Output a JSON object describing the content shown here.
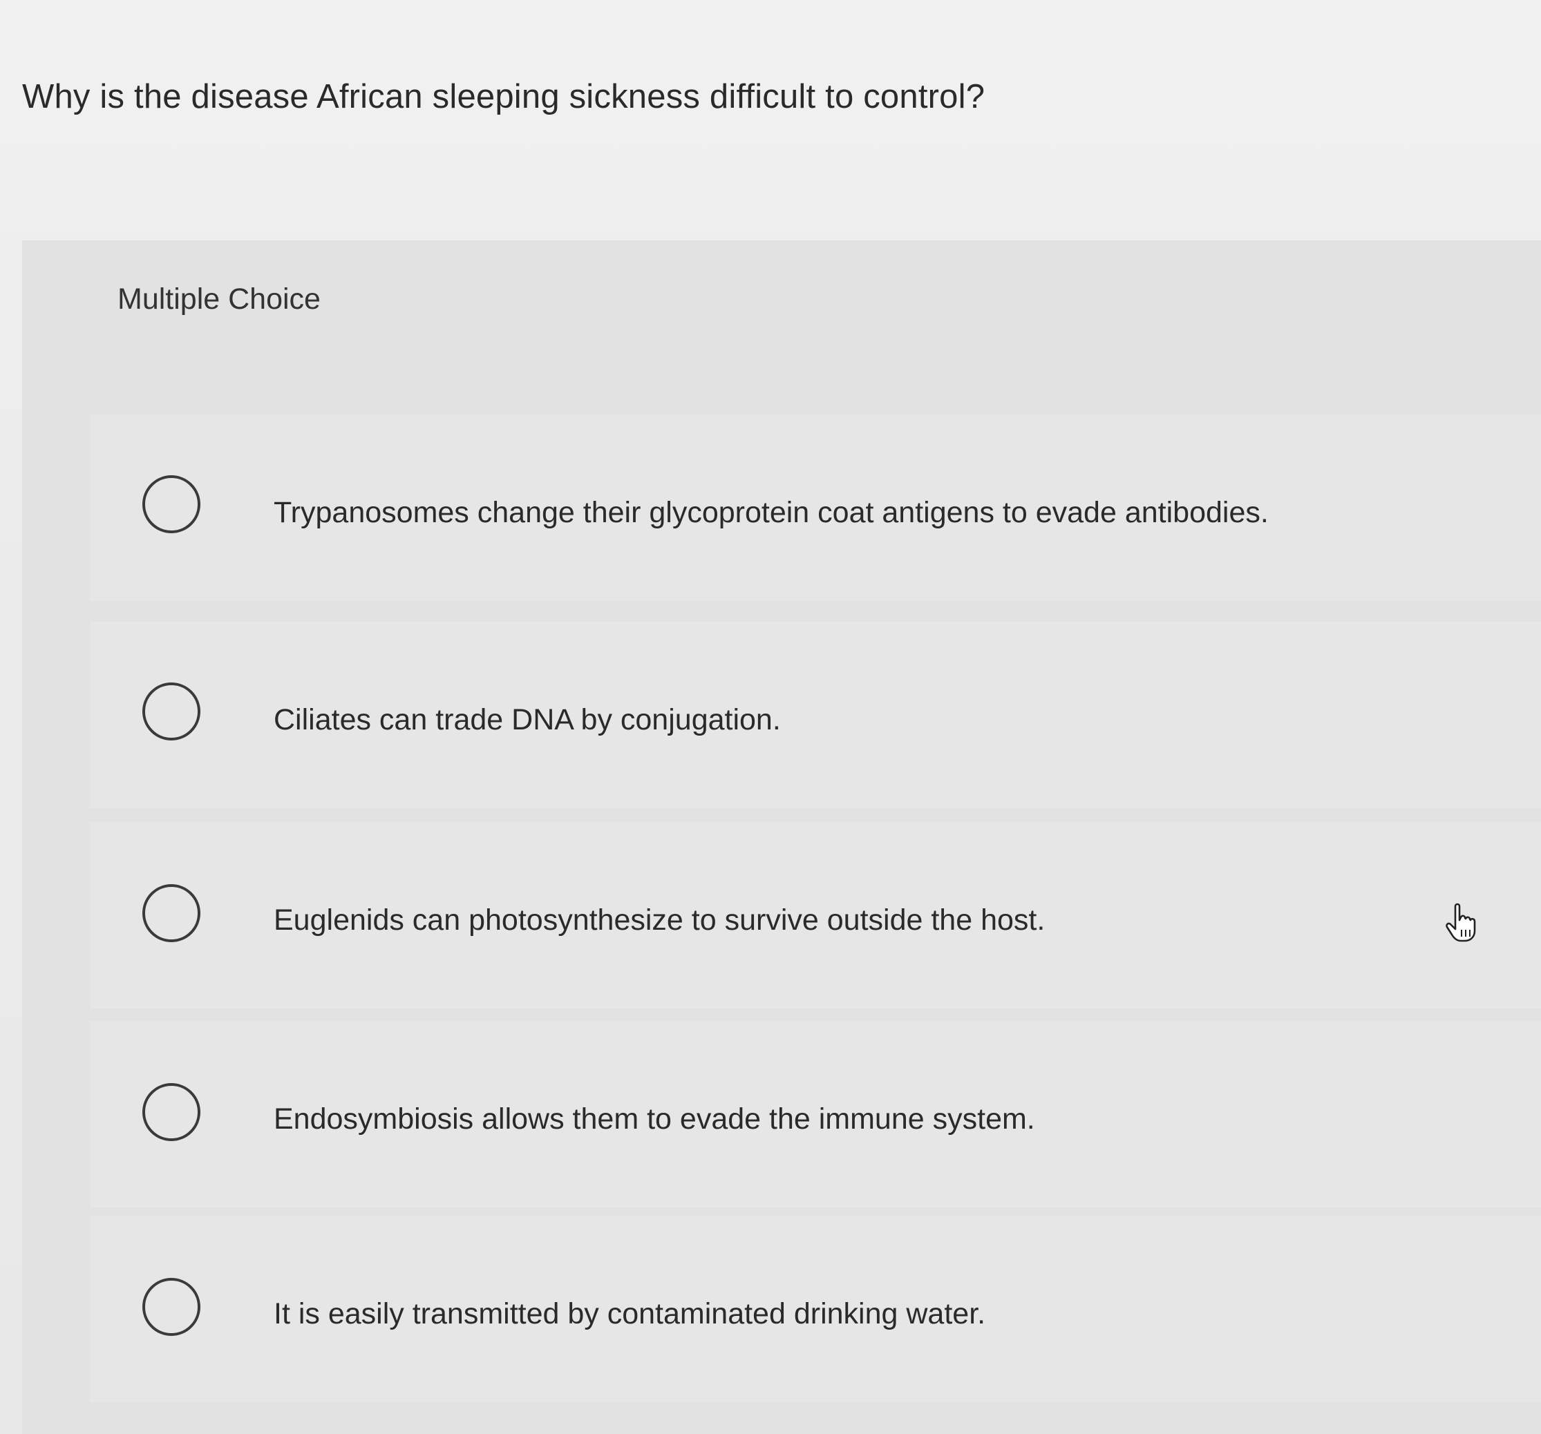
{
  "question": {
    "text": "Why is the disease African sleeping sickness difficult to control?"
  },
  "question_type": "Multiple Choice",
  "choices": [
    {
      "label": "Trypanosomes change their glycoprotein coat antigens to evade antibodies.",
      "selected": false
    },
    {
      "label": "Ciliates can trade DNA by conjugation.",
      "selected": false
    },
    {
      "label": "Euglenids can photosynthesize to survive outside the host.",
      "selected": false
    },
    {
      "label": "Endosymbiosis allows them to evade the immune system.",
      "selected": false
    },
    {
      "label": "It is easily transmitted by contaminated drinking water.",
      "selected": false
    }
  ],
  "icons": {
    "radio": "radio-unselected-icon",
    "pointer": "hand-pointer-icon"
  },
  "colors": {
    "text": "#2a2a2a",
    "radio_border": "#3a3a3a",
    "panel": "#e2e2e2"
  }
}
